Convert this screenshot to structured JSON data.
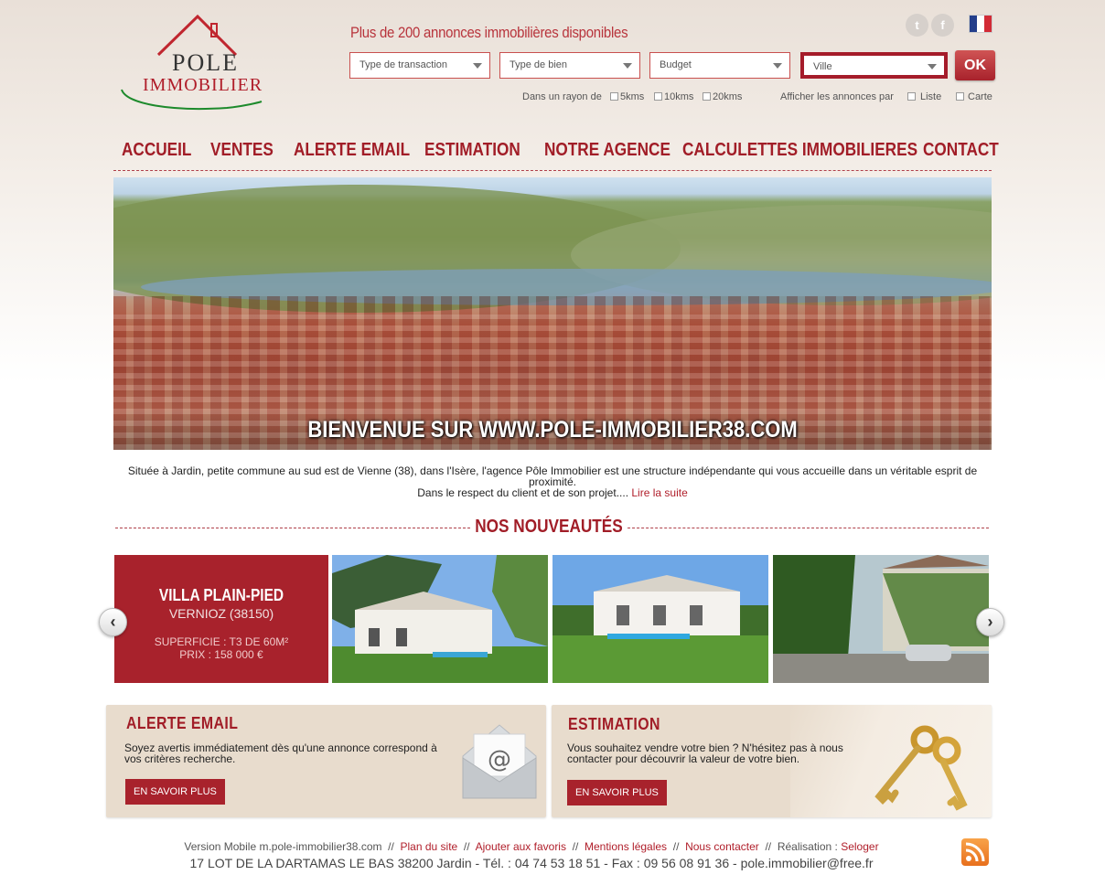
{
  "logo": {
    "line1": "POLE",
    "line2": "IMMOBILIER"
  },
  "header": {
    "tagline": "Plus de 200 annonces immobilières disponibles",
    "social": {
      "twitter": "twitter-icon",
      "facebook": "facebook-icon"
    },
    "language": "fr"
  },
  "search": {
    "transaction": "Type de transaction",
    "bien": "Type de bien",
    "budget": "Budget",
    "ville": "Ville",
    "ok": "OK",
    "radius_label": "Dans un rayon de",
    "r5": "5kms",
    "r10": "10kms",
    "r20": "20kms",
    "display_label": "Afficher les annonces par",
    "liste": "Liste",
    "carte": "Carte"
  },
  "nav": [
    "ACCUEIL",
    "VENTES",
    "ALERTE EMAIL",
    "ESTIMATION",
    "NOTRE AGENCE",
    "CALCULETTES IMMOBILIERES",
    "CONTACT"
  ],
  "hero": {
    "title": "BIENVENUE SUR WWW.POLE-IMMOBILIER38.COM"
  },
  "intro": {
    "line1": "Située à Jardin, petite commune au sud est de Vienne (38), dans l'Isère, l'agence Pôle Immobilier est une structure indépendante qui vous accueille dans un véritable esprit de",
    "line2": "proximité.",
    "line3": "Dans le respect du client et de son projet....",
    "link": "Lire la suite"
  },
  "nouveautes": {
    "title": "NOS NOUVEAUTÉS",
    "featured": {
      "title": "VILLA PLAIN-PIED",
      "location": "VERNIOZ (38150)",
      "superficie": "SUPERFICIE : T3 DE 60M²",
      "prix": "PRIX : 158 000 €"
    }
  },
  "boxes": {
    "alerte": {
      "title": "ALERTE EMAIL",
      "text": "Soyez avertis immédiatement dès qu'une annonce correspond à vos critères recherche.",
      "button": "EN SAVOIR PLUS"
    },
    "estimation": {
      "title": "ESTIMATION",
      "text": "Vous souhaitez vendre votre bien ? N'hésitez pas à nous contacter pour découvrir la valeur de votre bien.",
      "button": "EN SAVOIR PLUS"
    }
  },
  "footer": {
    "mobile": "Version Mobile m.pole-immobilier38.com",
    "sep": "//",
    "plan": "Plan du site",
    "favoris": "Ajouter aux favoris",
    "mentions": "Mentions légales",
    "contact": "Nous contacter",
    "realisation": "Réalisation :",
    "seloger": "Seloger",
    "address": "17 LOT DE LA DARTAMAS LE BAS 38200 Jardin - Tél. : 04 74 53 18 51 - Fax : 09 56 08 91 36 - pole.immobilier@free.fr"
  },
  "colors": {
    "brand": "#a8222c",
    "title": "#a11d27",
    "box_bg": "#e8dccd"
  }
}
